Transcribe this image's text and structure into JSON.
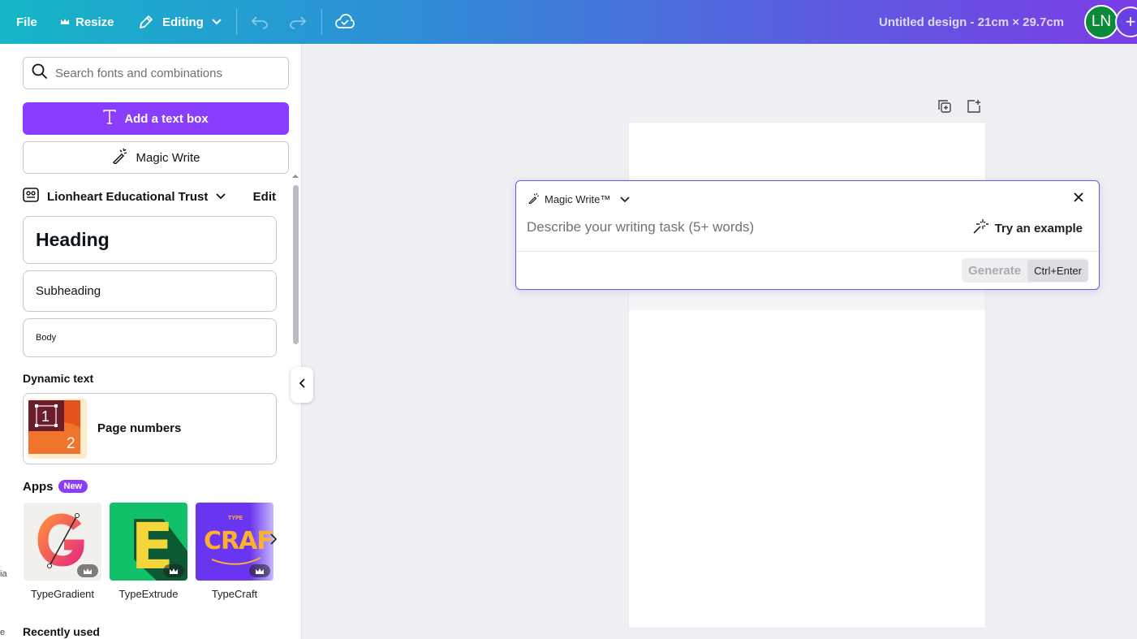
{
  "topbar": {
    "file_label": "File",
    "resize_label": "Resize",
    "editing_label": "Editing",
    "doc_title": "Untitled design - 21cm × 29.7cm",
    "avatar_initials": "LN",
    "plus_label": "+"
  },
  "panel": {
    "search_placeholder": "Search fonts and combinations",
    "add_text_box": "Add a text box",
    "magic_write": "Magic Write",
    "brand_name": "Lionheart Educational Trust",
    "brand_edit": "Edit",
    "styles": {
      "heading": "Heading",
      "subheading": "Subheading",
      "body": "Body"
    },
    "dynamic_text_title": "Dynamic text",
    "page_numbers_label": "Page numbers",
    "page_numbers_thumb": {
      "one": "1",
      "two": "2"
    },
    "apps_title": "Apps",
    "apps_badge": "New",
    "apps": [
      {
        "name": "TypeGradient",
        "icon": "letter-g-gradient"
      },
      {
        "name": "TypeExtrude",
        "icon": "letter-e-extruded",
        "glyph": "E"
      },
      {
        "name": "TypeCraft",
        "icon": "craft-wordmark",
        "glyph_top": "TYPE",
        "glyph": "CRAFT"
      }
    ],
    "recently_used_title": "Recently used",
    "rail_fragments": [
      "ia",
      "e"
    ]
  },
  "magic_write_popup": {
    "title": "Magic Write™",
    "input_placeholder": "Describe your writing task (5+ words)",
    "try_example": "Try an example",
    "generate_label": "Generate",
    "shortcut": "Ctrl+Enter"
  },
  "colors": {
    "accent_purple": "#8b3dff",
    "avatar_green": "#0b8a3a",
    "topbar_gradient_start": "#15b6c8",
    "topbar_gradient_end": "#7a3ce6"
  }
}
